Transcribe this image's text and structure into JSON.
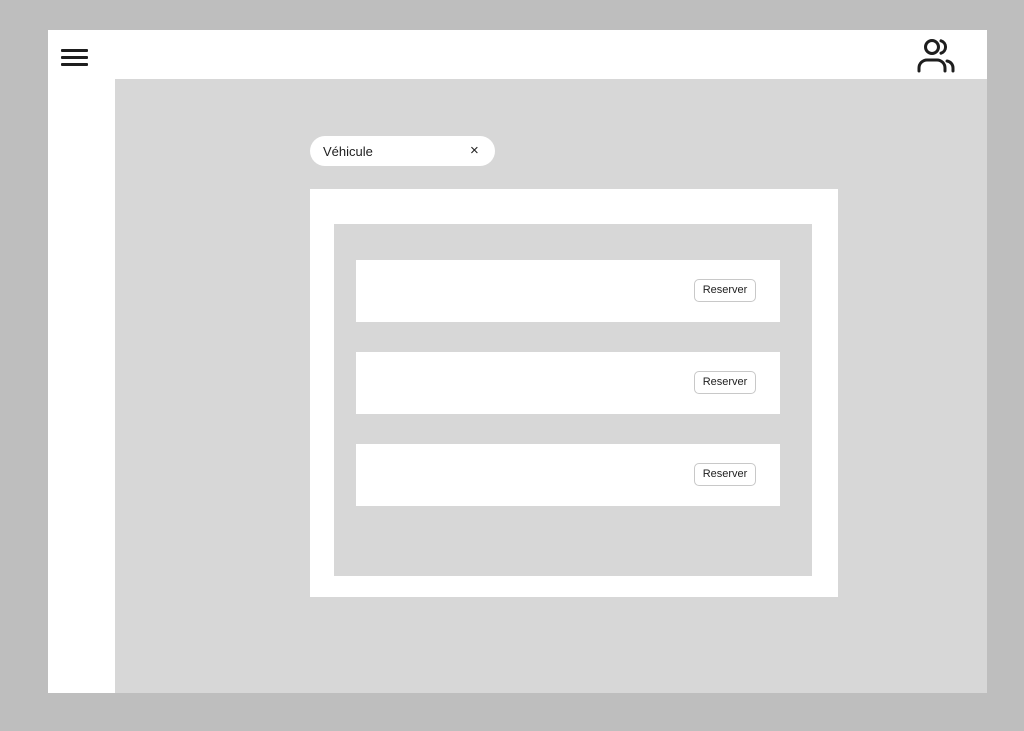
{
  "header": {
    "menu_icon": "hamburger-menu-icon",
    "user_icon": "users-icon"
  },
  "filter": {
    "label": "Véhicule",
    "close_glyph": "×"
  },
  "results": [
    {
      "button_label": "Reserver"
    },
    {
      "button_label": "Reserver"
    },
    {
      "button_label": "Reserver"
    }
  ],
  "colors": {
    "page_bg": "#bebebe",
    "content_bg": "#d7d7d7",
    "surface": "#ffffff",
    "text": "#1e1e1e"
  }
}
